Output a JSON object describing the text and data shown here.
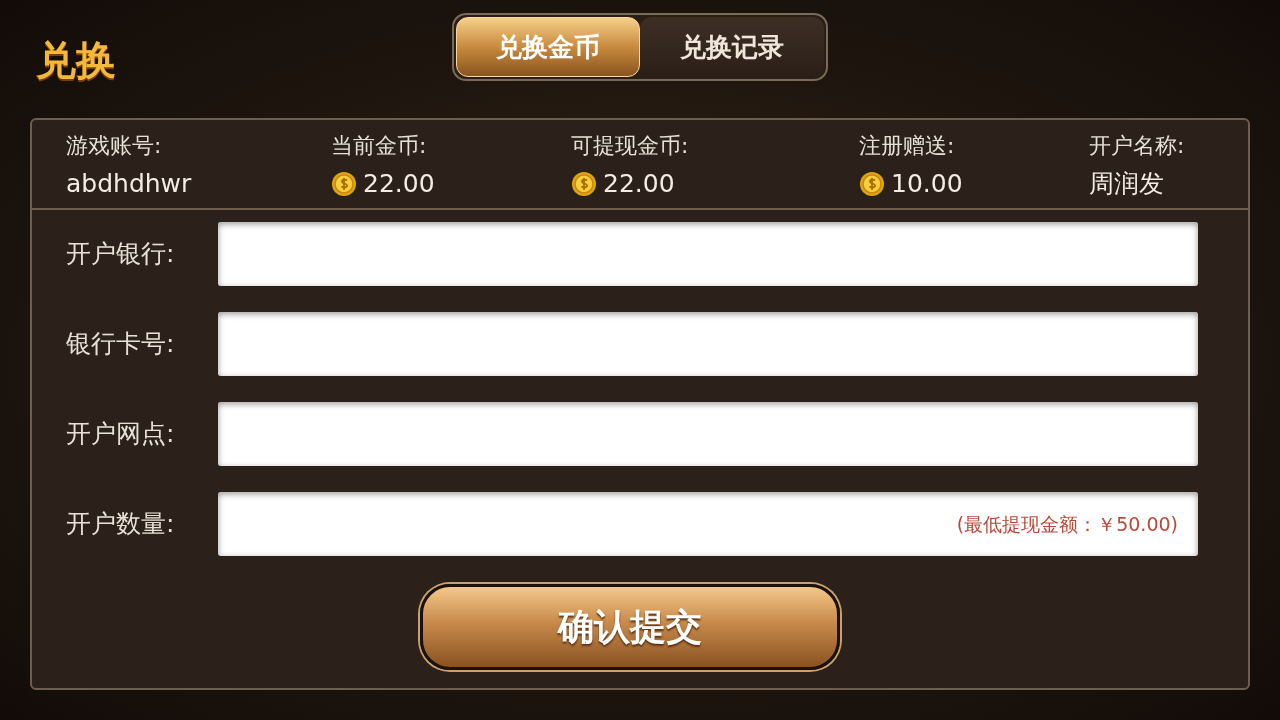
{
  "title": "兑换",
  "tabs": [
    {
      "label": "兑换金币",
      "selected": true
    },
    {
      "label": "兑换记录",
      "selected": false
    }
  ],
  "info": [
    {
      "label": "游戏账号:",
      "value": "abdhdhwr",
      "coin": false
    },
    {
      "label": "当前金币:",
      "value": "22.00",
      "coin": true
    },
    {
      "label": "可提现金币:",
      "value": "22.00",
      "coin": true
    },
    {
      "label": "注册赠送:",
      "value": "10.00",
      "coin": true
    },
    {
      "label": "开户名称:",
      "value": "周润发",
      "coin": false
    }
  ],
  "fields": [
    {
      "label": "开户银行:"
    },
    {
      "label": "银行卡号:"
    },
    {
      "label": "开户网点:"
    },
    {
      "label": "开户数量:",
      "note": "(最低提现金额：￥50.00)"
    }
  ],
  "submit": "确认提交"
}
